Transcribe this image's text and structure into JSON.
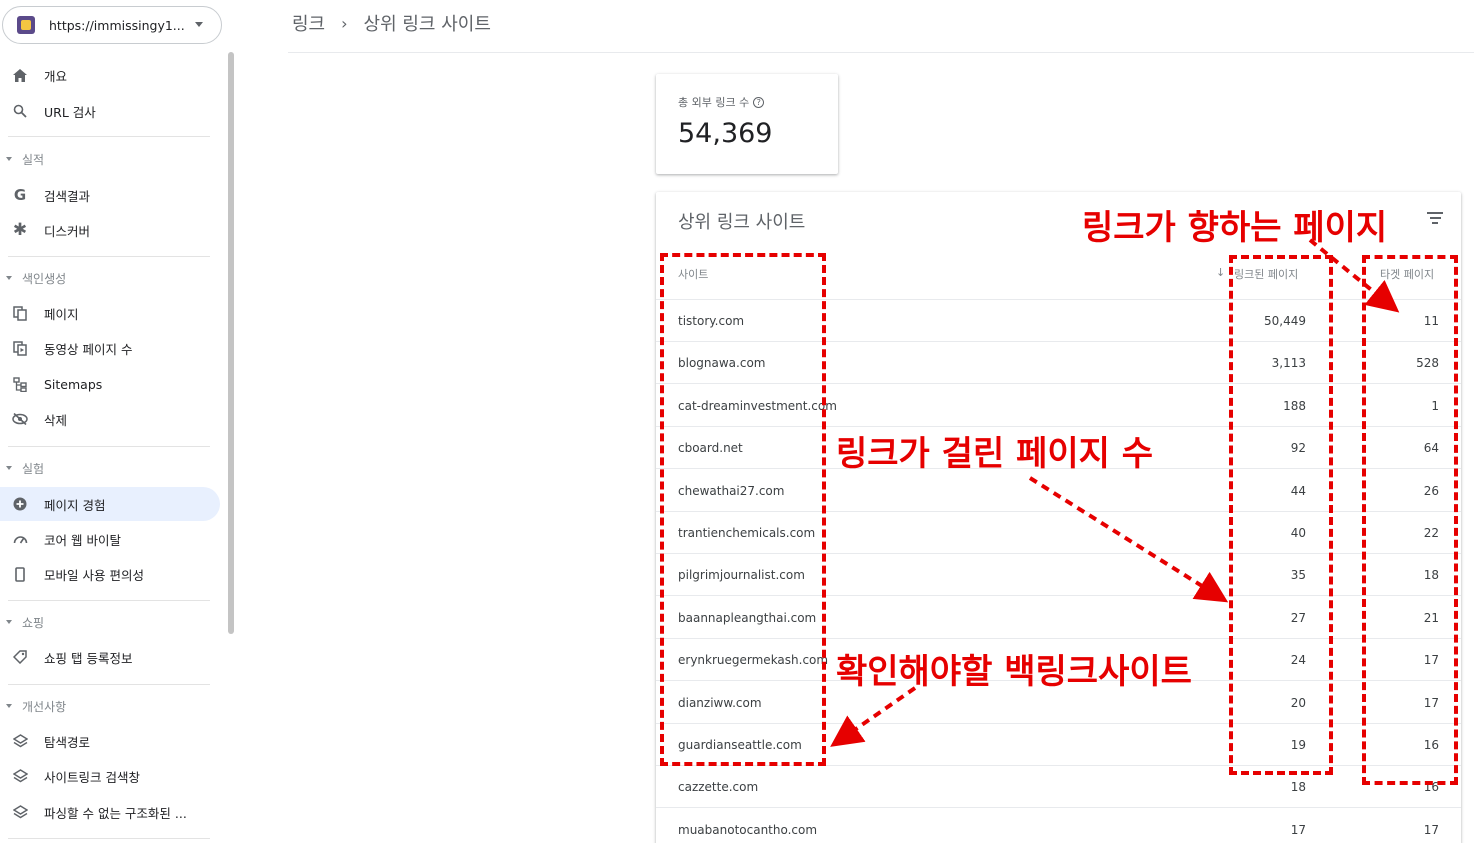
{
  "sidebar": {
    "property_url": "https://immissingy1...",
    "items": [
      {
        "label": "개요"
      },
      {
        "label": "URL 검사"
      },
      {
        "label": "검색결과"
      },
      {
        "label": "디스커버"
      },
      {
        "label": "페이지"
      },
      {
        "label": "동영상 페이지 수"
      },
      {
        "label": "Sitemaps"
      },
      {
        "label": "삭제"
      },
      {
        "label": "페이지 경험"
      },
      {
        "label": "코어 웹 바이탈"
      },
      {
        "label": "모바일 사용 편의성"
      },
      {
        "label": "쇼핑 탭 등록정보"
      },
      {
        "label": "탐색경로"
      },
      {
        "label": "사이트링크 검색창"
      },
      {
        "label": "파싱할 수 없는 구조화된 ..."
      }
    ],
    "sections": [
      "실적",
      "색인생성",
      "실험",
      "쇼핑",
      "개선사항"
    ]
  },
  "breadcrumb": {
    "parent": "링크",
    "current": "상위 링크 사이트"
  },
  "stat": {
    "label": "총 외부 링크 수",
    "value": "54,369"
  },
  "table": {
    "title": "상위 링크 사이트",
    "columns": {
      "site": "사이트",
      "linked": "링크된 페이지",
      "target": "타겟 페이지"
    },
    "rows": [
      {
        "site": "tistory.com",
        "linked": "50,449",
        "target": "11"
      },
      {
        "site": "blognawa.com",
        "linked": "3,113",
        "target": "528"
      },
      {
        "site": "cat-dreaminvestment.com",
        "linked": "188",
        "target": "1"
      },
      {
        "site": "cboard.net",
        "linked": "92",
        "target": "64"
      },
      {
        "site": "chewathai27.com",
        "linked": "44",
        "target": "26"
      },
      {
        "site": "trantienchemicals.com",
        "linked": "40",
        "target": "22"
      },
      {
        "site": "pilgrimjournalist.com",
        "linked": "35",
        "target": "18"
      },
      {
        "site": "baannapleangthai.com",
        "linked": "27",
        "target": "21"
      },
      {
        "site": "erynkruegermekash.com",
        "linked": "24",
        "target": "17"
      },
      {
        "site": "dianziww.com",
        "linked": "20",
        "target": "17"
      },
      {
        "site": "guardianseattle.com",
        "linked": "19",
        "target": "16"
      },
      {
        "site": "cazzette.com",
        "linked": "18",
        "target": "16"
      },
      {
        "site": "muabanotocantho.com",
        "linked": "17",
        "target": "17"
      }
    ]
  },
  "annotations": {
    "target_pages": "링크가 향하는 페이지",
    "linked_pages": "링크가 걸린 페이지 수",
    "backlink_sites": "확인해야할 백링크사이트",
    "color": "#e60000"
  }
}
